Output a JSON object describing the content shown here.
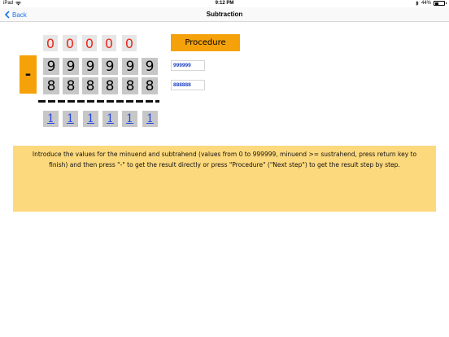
{
  "status_bar": {
    "device": "iPad",
    "wifi_icon": "wifi-icon",
    "time": "9:12 PM",
    "bluetooth_icon": "bluetooth-icon",
    "battery_percent": "44%",
    "battery_level": 0.44
  },
  "nav": {
    "back_label": "Back",
    "title": "Subtraction"
  },
  "carry_row": [
    "0",
    "0",
    "0",
    "0",
    "0"
  ],
  "minuend_digits": [
    "9",
    "9",
    "9",
    "9",
    "9",
    "9"
  ],
  "subtrahend_digits": [
    "8",
    "8",
    "8",
    "8",
    "8",
    "8"
  ],
  "result_digits": [
    "1",
    "1",
    "1",
    "1",
    "1",
    "1"
  ],
  "operator_label": "-",
  "procedure_label": "Procedure",
  "minuend_value": "999999",
  "subtrahend_value": "888888",
  "instructions_text": "Introduce the values for the minuend and subtrahend (values from 0 to 999999, minuend >= sustrahend, press return key to finish) and then press \"-\" to get the result directly or press \"Procedure\" (\"Next step\") to get the result step by step.",
  "colors": {
    "accent_orange": "#f5a10a",
    "carry_red": "#e8271a",
    "result_blue": "#2346e0",
    "input_blue": "#1c3fc0",
    "panel_yellow": "#fdd97d",
    "ios_blue": "#1a74e8"
  }
}
